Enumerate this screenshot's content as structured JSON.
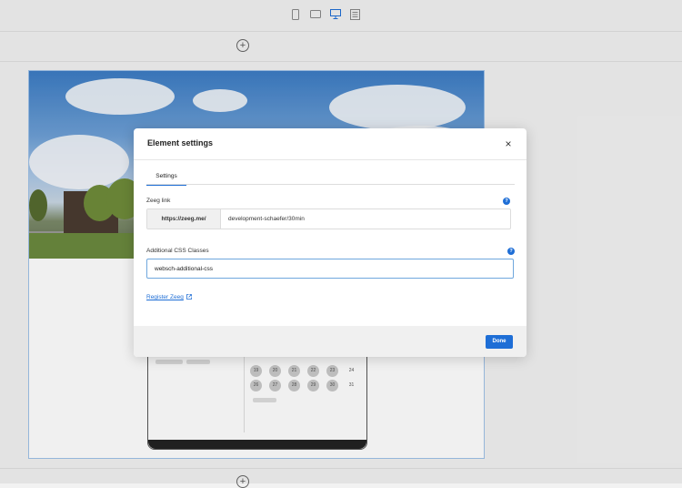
{
  "device_bar": {
    "icons": [
      "mobile-icon",
      "tablet-icon",
      "desktop-icon",
      "document-icon"
    ],
    "active": "desktop-icon"
  },
  "add_section": {
    "symbol": "+"
  },
  "calendar_preview": {
    "days": [
      "19",
      "20",
      "21",
      "22",
      "23",
      "24",
      "26",
      "27",
      "28",
      "29",
      "30",
      "31"
    ]
  },
  "modal": {
    "title": "Element settings",
    "close_symbol": "×",
    "tabs": [
      {
        "label": "Settings",
        "active": true
      }
    ],
    "zeeg_link": {
      "label": "Zeeg link",
      "help": "?",
      "prefix": "https://zeeg.me/",
      "value": "development-schaefer/30min"
    },
    "css_classes": {
      "label": "Additional CSS Classes",
      "help": "?",
      "value": "websch-additional-css"
    },
    "register_link": "Register Zeeg",
    "done_label": "Done"
  },
  "colors": {
    "accent": "#1e6ed6",
    "footer_bg": "#f0f0f0",
    "overlay": "rgba(0,0,0,0.06)"
  }
}
